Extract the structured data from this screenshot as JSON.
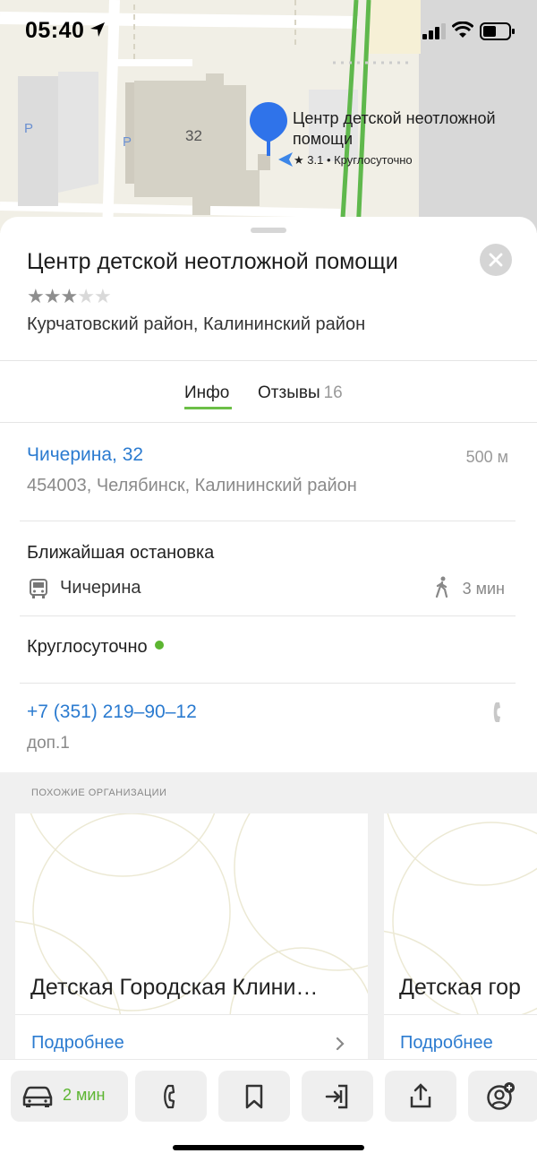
{
  "status_bar": {
    "time": "05:40"
  },
  "map": {
    "building_number": "32",
    "parking_labels": [
      "P",
      "P"
    ],
    "pin_title": "Центр детской неотложной помощи",
    "pin_subtitle": "★ 3.1 • Круглосуточно"
  },
  "organization": {
    "title": "Центр детской неотложной помощи",
    "rating_stars": 3,
    "max_stars": 5,
    "district": "Курчатовский район, Калининский район"
  },
  "tabs": {
    "info": "Инфо",
    "reviews": "Отзывы",
    "reviews_count": "16",
    "active": "info"
  },
  "address": {
    "street": "Чичерина, 32",
    "distance": "500 м",
    "full": "454003, Челябинск, Калининский район"
  },
  "stop": {
    "title": "Ближайшая остановка",
    "name": "Чичерина",
    "walk_time": "3 мин"
  },
  "hours": {
    "label": "Круглосуточно"
  },
  "phone": {
    "number": "+7 (351) 219‒90‒12",
    "extension": "доп.1"
  },
  "similar": {
    "header": "ПОХОЖИЕ ОРГАНИЗАЦИИ",
    "cards": [
      {
        "name": "Детская Городская Клини…",
        "more": "Подробнее"
      },
      {
        "name": "Детская гор",
        "more": "Подробнее"
      }
    ]
  },
  "actions": {
    "car_time": "2 мин",
    "icons": [
      "car-icon",
      "phone-icon",
      "bookmark-icon",
      "route-icon",
      "share-icon",
      "add-contact-icon"
    ]
  },
  "colors": {
    "accent_green": "#5cb531",
    "link_blue": "#2b7bd0",
    "pin_blue": "#2f73ea"
  }
}
